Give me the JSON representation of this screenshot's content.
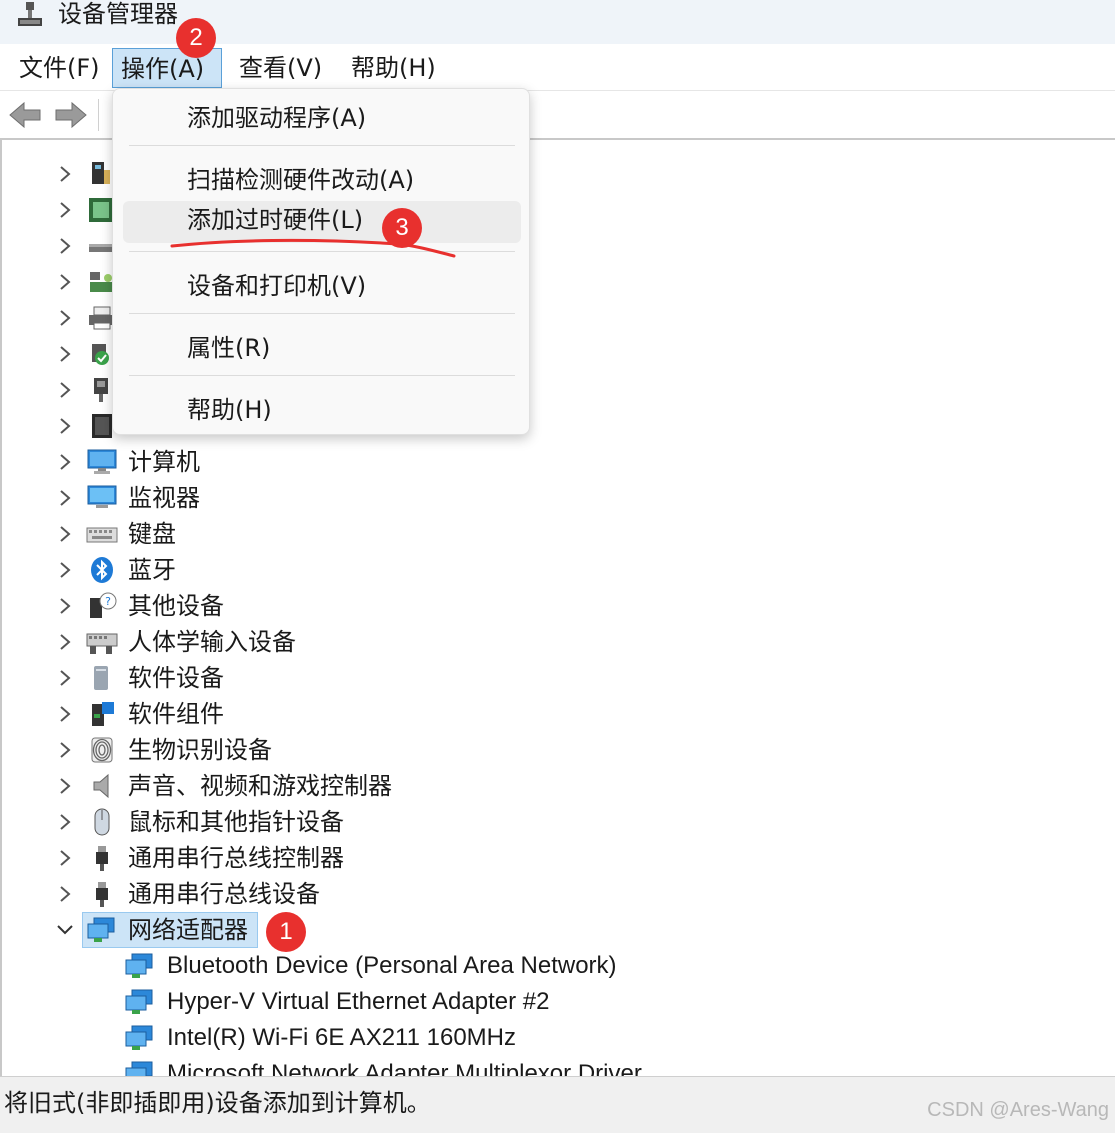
{
  "window": {
    "title": "设备管理器",
    "title_icon": "device-manager-icon"
  },
  "menubar": {
    "items": [
      {
        "label": "文件(F)"
      },
      {
        "label": "操作(A)"
      },
      {
        "label": "查看(V)"
      },
      {
        "label": "帮助(H)"
      }
    ]
  },
  "toolbar": {
    "back_icon": "arrow-left-icon",
    "forward_icon": "arrow-right-icon"
  },
  "action_menu": {
    "items": [
      {
        "label": "添加驱动程序(A)"
      },
      {
        "label": "扫描检测硬件改动(A)"
      },
      {
        "label": "添加过时硬件(L)"
      },
      {
        "label": "设备和打印机(V)"
      },
      {
        "label": "属性(R)"
      },
      {
        "label": "帮助(H)"
      }
    ]
  },
  "tree": {
    "categories": [
      {
        "label": "",
        "icon": "device-icon"
      },
      {
        "label": "",
        "icon": "processor-icon"
      },
      {
        "label": "",
        "icon": "disk-drive-icon"
      },
      {
        "label": "",
        "icon": "storage-controller-icon"
      },
      {
        "label": "",
        "icon": "printer-icon"
      },
      {
        "label": "",
        "icon": "network-service-icon"
      },
      {
        "label": "",
        "icon": "port-icon"
      },
      {
        "label": "",
        "icon": "firmware-icon"
      },
      {
        "label": "计算机",
        "icon": "computer-icon"
      },
      {
        "label": "监视器",
        "icon": "monitor-icon"
      },
      {
        "label": "键盘",
        "icon": "keyboard-icon"
      },
      {
        "label": "蓝牙",
        "icon": "bluetooth-icon"
      },
      {
        "label": "其他设备",
        "icon": "unknown-device-icon"
      },
      {
        "label": "人体学输入设备",
        "icon": "hid-icon"
      },
      {
        "label": "软件设备",
        "icon": "software-device-icon"
      },
      {
        "label": "软件组件",
        "icon": "software-component-icon"
      },
      {
        "label": "生物识别设备",
        "icon": "fingerprint-icon"
      },
      {
        "label": "声音、视频和游戏控制器",
        "icon": "speaker-icon"
      },
      {
        "label": "鼠标和其他指针设备",
        "icon": "mouse-icon"
      },
      {
        "label": "通用串行总线控制器",
        "icon": "usb-icon"
      },
      {
        "label": "通用串行总线设备",
        "icon": "usb-icon"
      }
    ],
    "expanded_category": {
      "label": "网络适配器",
      "icon": "network-adapter-icon"
    },
    "children": [
      {
        "label": "Bluetooth Device (Personal Area Network)"
      },
      {
        "label": "Hyper-V Virtual Ethernet Adapter #2"
      },
      {
        "label": "Intel(R) Wi-Fi 6E AX211 160MHz"
      },
      {
        "label": "Microsoft Network Adapter Multiplexor Driver"
      }
    ]
  },
  "annotations": {
    "badge_1": "1",
    "badge_2": "2",
    "badge_3": "3",
    "color": "#e8302e"
  },
  "statusbar": {
    "text": "将旧式(非即插即用)设备添加到计算机。"
  },
  "watermark": "CSDN @Ares-Wang"
}
